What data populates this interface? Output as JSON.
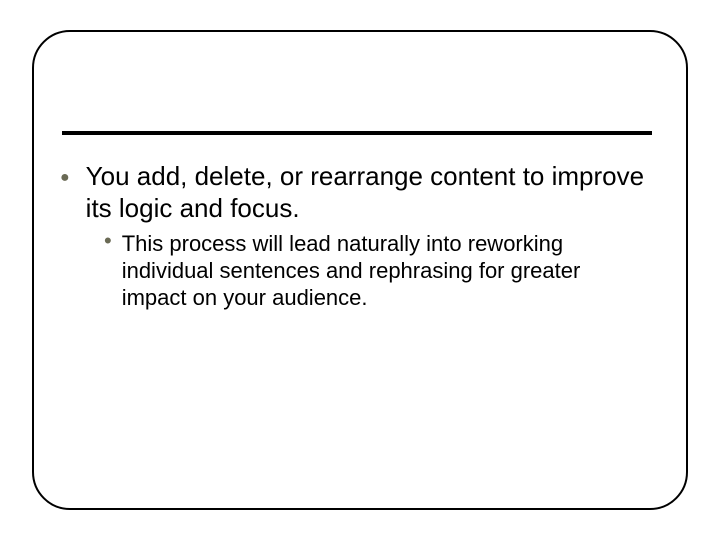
{
  "slide": {
    "bullets": [
      {
        "text": "You add, delete, or rearrange content to improve its logic and focus.",
        "sub": [
          {
            "text": "This process will lead naturally into reworking individual sentences and rephrasing for greater impact on your audience."
          }
        ]
      }
    ]
  }
}
